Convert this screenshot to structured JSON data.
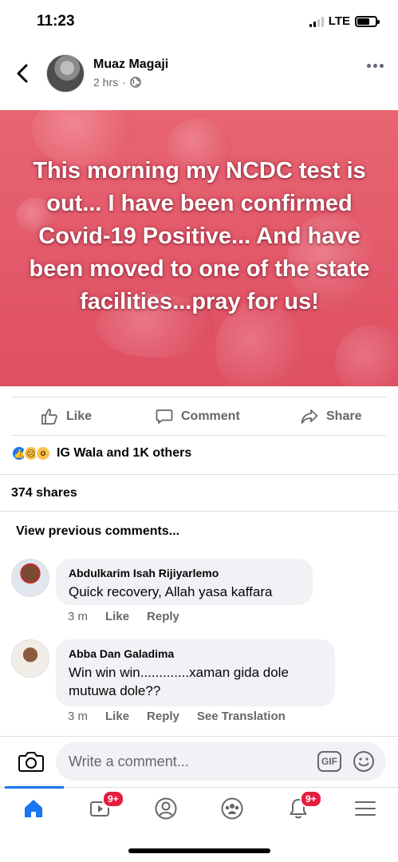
{
  "status_bar": {
    "time": "11:23",
    "network": "LTE"
  },
  "post": {
    "author": "Muaz Magaji",
    "time": "2 hrs",
    "separator": "·",
    "text": "This morning my NCDC test is out... I have been confirmed Covid-19 Positive... And have been moved to one of the state facilities...pray for us!",
    "banner_color": "#e3596a"
  },
  "actions": {
    "like": "Like",
    "comment": "Comment",
    "share": "Share"
  },
  "reactions": {
    "summary": "IG Wala and 1K others",
    "icons": [
      "like-icon",
      "sad-icon",
      "wow-icon"
    ]
  },
  "shares": "374 shares",
  "view_previous": "View previous comments...",
  "comments": [
    {
      "name": "Abdulkarim Isah Rijiyarlemo",
      "text": "Quick recovery, Allah yasa kaffara",
      "time": "3 m",
      "like": "Like",
      "reply": "Reply"
    },
    {
      "name": "Abba Dan Galadima",
      "text": "Win win win.............xaman gida dole mutuwa dole??",
      "time": "3 m",
      "like": "Like",
      "reply": "Reply",
      "translate": "See Translation"
    }
  ],
  "composer": {
    "placeholder": "Write a comment...",
    "gif": "GIF"
  },
  "bottom_nav": {
    "items": [
      "home-icon",
      "watch-icon",
      "profile-icon",
      "groups-icon",
      "notifications-icon",
      "menu-icon"
    ],
    "watch_badge": "9+",
    "notifications_badge": "9+",
    "accent": "#1877f2"
  }
}
